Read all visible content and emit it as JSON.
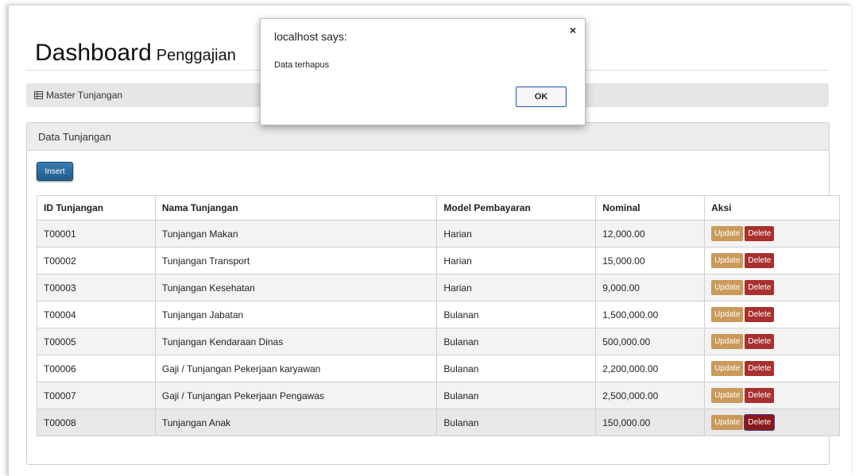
{
  "header": {
    "title": "Dashboard",
    "subtitle": "Penggajian"
  },
  "breadcrumb": {
    "icon": "table-icon",
    "label": "Master Tunjangan"
  },
  "panel": {
    "heading": "Data Tunjangan",
    "insert_label": "Insert"
  },
  "table": {
    "headers": [
      "ID Tunjangan",
      "Nama Tunjangan",
      "Model Pembayaran",
      "Nominal",
      "Aksi"
    ],
    "update_label": "Update",
    "delete_label": "Delete",
    "rows": [
      {
        "id": "T00001",
        "nama": "Tunjangan Makan",
        "model": "Harian",
        "nominal": "12,000.00"
      },
      {
        "id": "T00002",
        "nama": "Tunjangan Transport",
        "model": "Harian",
        "nominal": "15,000.00"
      },
      {
        "id": "T00003",
        "nama": "Tunjangan Kesehatan",
        "model": "Harian",
        "nominal": "9,000.00"
      },
      {
        "id": "T00004",
        "nama": "Tunjangan Jabatan",
        "model": "Bulanan",
        "nominal": "1,500,000.00"
      },
      {
        "id": "T00005",
        "nama": "Tunjangan Kendaraan Dinas",
        "model": "Bulanan",
        "nominal": "500,000.00"
      },
      {
        "id": "T00006",
        "nama": "Gaji / Tunjangan Pekerjaan karyawan",
        "model": "Bulanan",
        "nominal": "2,200,000.00"
      },
      {
        "id": "T00007",
        "nama": "Gaji / Tunjangan Pekerjaan Pengawas",
        "model": "Bulanan",
        "nominal": "2,500,000.00"
      },
      {
        "id": "T00008",
        "nama": "Tunjangan Anak",
        "model": "Bulanan",
        "nominal": "150,000.00"
      }
    ]
  },
  "dialog": {
    "title": "localhost says:",
    "message": "Data terhapus",
    "ok_label": "OK",
    "close_glyph": "×"
  },
  "colors": {
    "insert_button": "#2a6a9e",
    "update_button": "#c99a5a",
    "delete_button": "#a8302f",
    "breadcrumb_bg": "#e6e6e6"
  }
}
